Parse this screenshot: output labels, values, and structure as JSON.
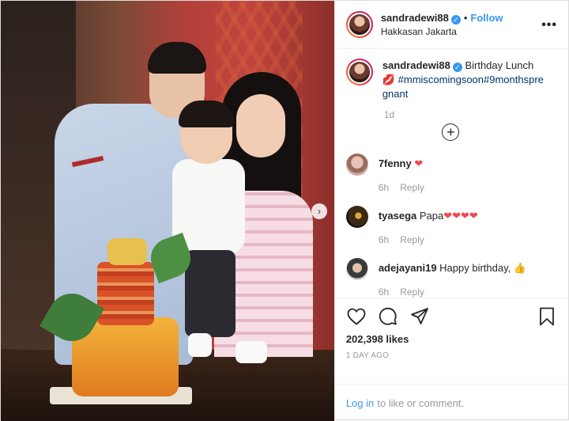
{
  "post": {
    "username": "sandradewi88",
    "follow_label": "Follow",
    "separator": "•",
    "location": "Hakkasan Jakarta",
    "more_label": "•••"
  },
  "caption": {
    "username": "sandradewi88",
    "text": "Birthday Lunch",
    "emoji": "💋",
    "hashtags": "#mmiscomingsoon#9monthspregnant",
    "timestamp": "1d"
  },
  "comments": [
    {
      "username": "7fenny",
      "text": "",
      "emoji": "❤",
      "time": "6h",
      "reply_label": "Reply"
    },
    {
      "username": "tyasega",
      "text": "Papa",
      "emoji": "❤❤❤❤",
      "time": "6h",
      "reply_label": "Reply"
    },
    {
      "username": "adejayani19",
      "text": "Happy birthday,",
      "emoji": "👍",
      "time": "6h",
      "reply_label": "Reply"
    }
  ],
  "stats": {
    "likes": "202,398 likes",
    "date": "1 DAY AGO"
  },
  "login": {
    "link": "Log in",
    "suffix": "to like or comment."
  },
  "colors": {
    "accent": "#3897f0",
    "muted": "#999999",
    "heart": "#ed4956"
  },
  "icons": [
    "heart-icon",
    "comment-icon",
    "share-icon",
    "bookmark-icon",
    "plus-circle-icon",
    "verified-icon",
    "chevron-right-icon"
  ]
}
